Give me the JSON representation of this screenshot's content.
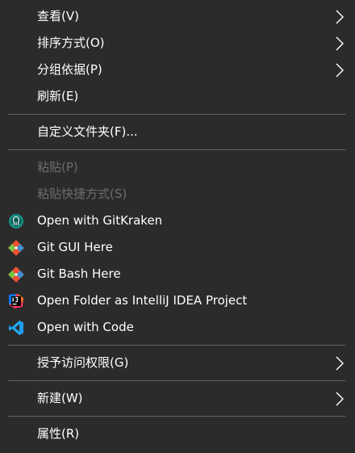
{
  "menu": {
    "view": "查看(V)",
    "sort": "排序方式(O)",
    "group": "分组依据(P)",
    "refresh": "刷新(E)",
    "customize": "自定义文件夹(F)...",
    "paste": "粘贴(P)",
    "paste_shortcut": "粘贴快捷方式(S)",
    "gitkraken": "Open with GitKraken",
    "git_gui": "Git GUI Here",
    "git_bash": "Git Bash Here",
    "intellij": "Open Folder as IntelliJ IDEA Project",
    "vscode": "Open with Code",
    "grant_access": "授予访问权限(G)",
    "new": "新建(W)",
    "properties": "属性(R)"
  },
  "colors": {
    "background": "#2b2b2b",
    "text": "#ffffff",
    "disabled_text": "#6d6d6d",
    "separator": "#646464",
    "gitkraken": "#179287",
    "git": "#f05133",
    "vscode": "#23a9f2"
  },
  "icons": {
    "submenu_arrow": "chevron-right-icon",
    "gitkraken": "gitkraken-icon",
    "git": "git-icon",
    "intellij": "intellij-idea-icon",
    "vscode": "vscode-icon"
  }
}
